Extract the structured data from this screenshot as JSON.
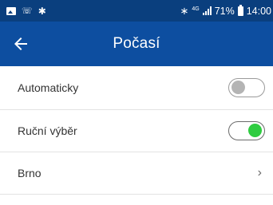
{
  "status_bar": {
    "left_icons": [
      "image-icon",
      "missed-call-icon",
      "bug-icon"
    ],
    "network_type": "4G",
    "battery_percent": "71%",
    "time": "14:00",
    "colors": {
      "background": "#0a3f7e"
    }
  },
  "app_bar": {
    "title": "Počasí",
    "back_icon": "arrow-left-icon",
    "colors": {
      "background": "#0d4ea0"
    }
  },
  "settings": [
    {
      "label": "Automaticky",
      "control": "toggle",
      "checked": false
    },
    {
      "label": "Ruční výběr",
      "control": "toggle",
      "checked": true
    },
    {
      "label": "Brno",
      "control": "chevron",
      "chevron": "›"
    }
  ],
  "colors": {
    "toggle_on": "#2ecc40",
    "toggle_off_knob": "#b4b4b4"
  }
}
